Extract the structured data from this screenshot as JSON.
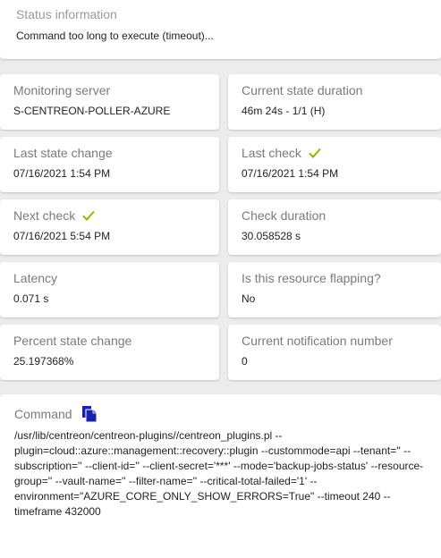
{
  "status": {
    "title": "Status information",
    "value": "Command too long to execute (timeout)..."
  },
  "tiles": [
    {
      "label": "Monitoring server",
      "value": "S-CENTREON-POLLER-AZURE",
      "check": false
    },
    {
      "label": "Current state duration",
      "value": "46m 24s - 1/1 (H)",
      "check": false
    },
    {
      "label": "Last state change",
      "value": "07/16/2021 1:54 PM",
      "check": false
    },
    {
      "label": "Last check",
      "value": "07/16/2021 1:54 PM",
      "check": true
    },
    {
      "label": "Next check",
      "value": "07/16/2021 5:54 PM",
      "check": true
    },
    {
      "label": "Check duration",
      "value": "30.058528 s",
      "check": false
    },
    {
      "label": "Latency",
      "value": "0.071 s",
      "check": false
    },
    {
      "label": "Is this resource flapping?",
      "value": "No",
      "check": false
    },
    {
      "label": "Percent state change",
      "value": "25.197368%",
      "check": false
    },
    {
      "label": "Current notification number",
      "value": "0",
      "check": false
    }
  ],
  "command": {
    "label": "Command",
    "text": "/usr/lib/centreon/centreon-plugins//centreon_plugins.pl --plugin=cloud::azure::management::recovery::plugin --custommode=api --tenant='' --subscription='' --client-id='' --client-secret='***' --mode='backup-jobs-status' --resource-group='' --vault-name='' --filter-name='' --critical-total-failed='1' --environment=\"AZURE_CORE_ONLY_SHOW_ERRORS=True\" --timeout 240 --timeframe 432000"
  },
  "colors": {
    "accent": "#2e3192",
    "check": "#84bd00",
    "copy_icon": "#1a22a8"
  },
  "icons": {
    "check": "check-icon",
    "copy": "copy-icon"
  }
}
